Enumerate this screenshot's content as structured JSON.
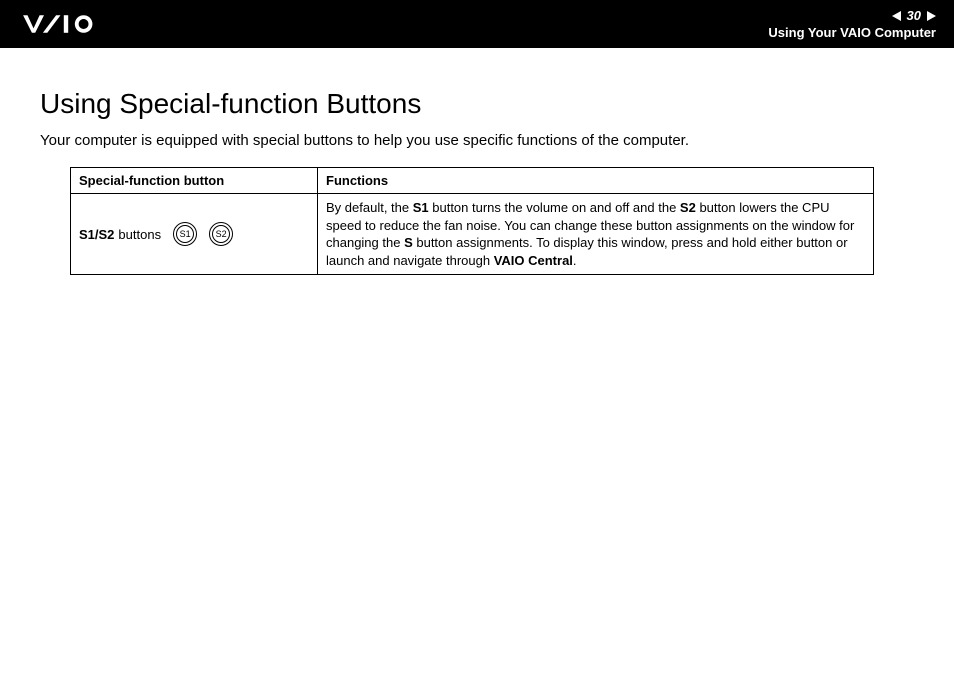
{
  "header": {
    "page_number": "30",
    "section": "Using Your VAIO Computer"
  },
  "content": {
    "heading": "Using Special-function Buttons",
    "intro": "Your computer is equipped with special buttons to help you use specific functions of the computer."
  },
  "table": {
    "headers": {
      "col1": "Special-function button",
      "col2": "Functions"
    },
    "row1": {
      "label_bold": "S1/S2",
      "label_rest": " buttons",
      "icon1": "S1",
      "icon2": "S2",
      "func_pre": "By default, the ",
      "func_b1": "S1",
      "func_mid1": " button turns the volume on and off and the ",
      "func_b2": "S2",
      "func_mid2": " button lowers the CPU speed to reduce the fan noise. You can change these button assignments on the window for changing the ",
      "func_b3": "S",
      "func_mid3": " button assignments. To display this window, press and hold either button or launch and navigate through ",
      "func_b4": "VAIO Central",
      "func_end": "."
    }
  }
}
